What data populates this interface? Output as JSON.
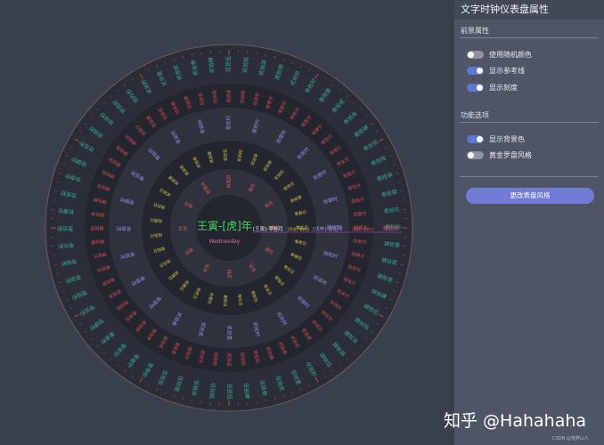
{
  "center": {
    "year_text": "王寅-[虎]年",
    "weekday": "Wednesday"
  },
  "readout": {
    "month": "[王寅]-零叁月",
    "day": "[丙戌]-零贰日",
    "hour": "[戊申]-拾伍时",
    "minute": "[庚寅]-拾贰分",
    "second": "肆拾秒"
  },
  "panel": {
    "title": "文字时钟仪表盘属性",
    "foreground_section": "前景属性",
    "options": [
      {
        "label": "使用随机颜色",
        "on": false
      },
      {
        "label": "显示参考线",
        "on": true
      },
      {
        "label": "显示刻度",
        "on": true
      }
    ],
    "function_section": "功能选项",
    "functions": [
      {
        "label": "显示背景色",
        "on": true
      },
      {
        "label": "黄金罗盘风格",
        "on": false
      }
    ],
    "button_label": "更改表盘风格"
  },
  "watermark": "知乎 @Hahahaha",
  "credit": "CSDN @荒野山人",
  "colors": {
    "background": "#3a3f4e",
    "dial_outer": "#2a2d37",
    "ring_dark": "#22252e",
    "ring_light": "#2f323d",
    "second_color": "#3aa88e",
    "minute_color": "#d24b4b",
    "hour_color": "#8e8ee8",
    "day_color": "#d6c04f",
    "month_color": "#e05a5a",
    "tick_color": "#c0503a",
    "accent": "#5a78d6"
  },
  "rings": {
    "seconds": [
      "零零秒",
      "零壹秒",
      "零贰秒",
      "零叁秒",
      "零肆秒",
      "零伍秒",
      "零陆秒",
      "零柒秒",
      "零捌秒",
      "零玖秒",
      "壹拾秒",
      "拾壹秒",
      "拾贰秒",
      "拾叁秒",
      "拾肆秒",
      "拾伍秒",
      "拾陆秒",
      "拾柒秒",
      "拾捌秒",
      "拾玖秒",
      "贰拾秒",
      "贰拾壹",
      "贰拾贰",
      "贰拾叁",
      "贰拾肆",
      "贰拾伍",
      "贰拾陆",
      "贰拾柒",
      "贰拾捌",
      "贰拾玖",
      "叁拾秒",
      "叁拾壹",
      "叁拾贰",
      "叁拾叁",
      "叁拾肆",
      "叁拾伍",
      "叁拾陆",
      "叁拾柒",
      "叁拾捌",
      "叁拾玖",
      "肆拾秒",
      "肆拾壹",
      "肆拾贰",
      "肆拾叁",
      "肆拾肆",
      "肆拾伍",
      "肆拾陆",
      "肆拾柒",
      "肆拾捌",
      "肆拾玖",
      "伍拾秒",
      "伍拾壹",
      "伍拾贰",
      "伍拾叁",
      "伍拾肆",
      "伍拾伍",
      "伍拾陆",
      "伍拾柒",
      "伍拾捌",
      "伍拾玖"
    ],
    "minutes": [
      "零零分",
      "零壹分",
      "零贰分",
      "零叁分",
      "零肆分",
      "零伍分",
      "零陆分",
      "零柒分",
      "零捌分",
      "零玖分",
      "壹拾分",
      "拾壹分",
      "拾贰分",
      "拾叁分",
      "拾肆分",
      "拾伍分",
      "拾陆分",
      "拾柒分",
      "拾捌分",
      "拾玖分",
      "贰拾分",
      "贰拾壹",
      "贰拾贰",
      "贰拾叁",
      "贰拾肆",
      "贰拾伍",
      "贰拾陆",
      "贰拾柒",
      "贰拾捌",
      "贰拾玖",
      "叁拾分",
      "叁拾壹",
      "叁拾贰",
      "叁拾叁",
      "叁拾肆",
      "叁拾伍",
      "叁拾陆",
      "叁拾柒",
      "叁拾捌",
      "叁拾玖",
      "肆拾分",
      "肆拾壹",
      "肆拾贰",
      "肆拾叁",
      "肆拾肆",
      "肆拾伍",
      "肆拾陆",
      "肆拾柒",
      "肆拾捌",
      "肆拾玖",
      "伍拾分",
      "伍拾壹",
      "伍拾贰",
      "伍拾叁",
      "伍拾肆",
      "伍拾伍",
      "伍拾陆",
      "伍拾柒",
      "伍拾捌",
      "伍拾玖"
    ],
    "hours": [
      "零零时",
      "零壹时",
      "零贰时",
      "零叁时",
      "零肆时",
      "零伍时",
      "零陆时",
      "零柒时",
      "零捌时",
      "零玖时",
      "壹拾时",
      "拾壹时",
      "拾贰时",
      "拾叁时",
      "拾肆时",
      "拾伍时",
      "拾陆时",
      "拾柒时",
      "拾捌时",
      "拾玖时",
      "贰拾时",
      "贰拾壹",
      "贰拾贰",
      "贰拾叁"
    ],
    "days": [
      "零壹日",
      "零贰日",
      "零叁日",
      "零肆日",
      "零伍日",
      "零陆日",
      "零柒日",
      "零捌日",
      "零玖日",
      "壹拾日",
      "拾壹日",
      "拾贰日",
      "拾叁日",
      "拾肆日",
      "拾伍日",
      "拾陆日",
      "拾柒日",
      "拾捌日",
      "拾玖日",
      "贰拾日",
      "贰拾壹",
      "贰拾贰",
      "贰拾叁",
      "贰拾肆",
      "贰拾伍",
      "贰拾陆",
      "贰拾柒",
      "贰拾捌",
      "贰拾玖",
      "叁拾日",
      "叁拾壹"
    ],
    "months": [
      "壹月",
      "贰月",
      "叁月",
      "肆月",
      "伍月",
      "陆月",
      "柒月",
      "捌月",
      "玖月",
      "拾月",
      "拾壹月",
      "拾贰月"
    ]
  }
}
